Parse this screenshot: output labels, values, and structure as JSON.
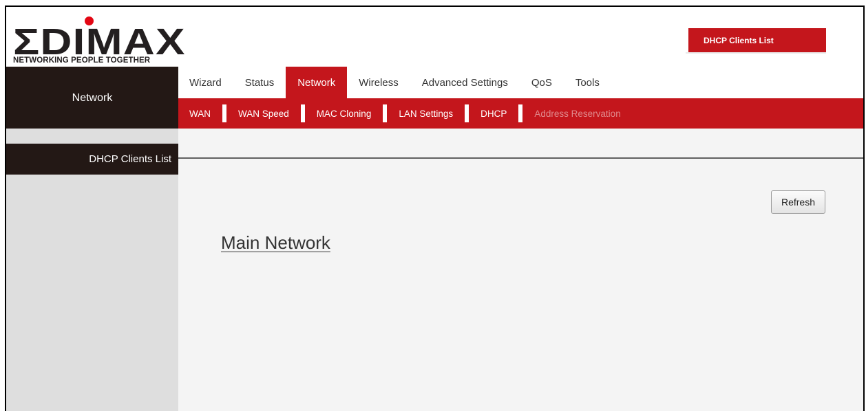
{
  "logo": {
    "word": "ΣDIMAX",
    "tagline": "NETWORKING PEOPLE TOGETHER",
    "brand_color": "#231f20",
    "dot_color": "#e30613"
  },
  "top_tab": {
    "label": "DHCP Clients List"
  },
  "sidebar": {
    "section": "Network",
    "items": [
      {
        "label": "DHCP Clients List",
        "active": true
      }
    ]
  },
  "main_menu": [
    {
      "label": "Wizard",
      "active": false
    },
    {
      "label": "Status",
      "active": false
    },
    {
      "label": "Network",
      "active": true
    },
    {
      "label": "Wireless",
      "active": false
    },
    {
      "label": "Advanced Settings",
      "active": false
    },
    {
      "label": "QoS",
      "active": false
    },
    {
      "label": "Tools",
      "active": false
    }
  ],
  "sub_menu": [
    {
      "label": "WAN"
    },
    {
      "label": "WAN Speed"
    },
    {
      "label": "MAC Cloning"
    },
    {
      "label": "LAN Settings"
    },
    {
      "label": "DHCP"
    },
    {
      "label": "Address Reservation",
      "disabled": true
    }
  ],
  "content": {
    "refresh_label": "Refresh",
    "section_title": "Main Network"
  },
  "colors": {
    "accent_red": "#c4161c",
    "dark": "#231815",
    "sidebar_bg": "#dedede",
    "content_bg": "#f4f4f4"
  }
}
